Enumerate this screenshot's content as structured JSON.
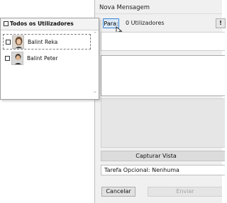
{
  "dialog": {
    "title": "Nova Mensagem",
    "to_button": "Para:",
    "recipients_count": "0 Utilizadores",
    "priority_button": "!",
    "capture_button": "Capturar Vista",
    "task_field": "Tarefa Opcional: Nenhuma",
    "cancel_button": "Cancelar",
    "send_button": "Enviar"
  },
  "user_popup": {
    "select_all_label": "Todos os Utilizadores",
    "users": [
      {
        "name": "Balint Reka",
        "checked": false,
        "focused": true
      },
      {
        "name": "Balint Peter",
        "checked": false,
        "focused": false
      }
    ]
  },
  "colors": {
    "accent": "#3a86d4",
    "to_button_bg": "#dbe9f7",
    "disabled_text": "#a4a4a4"
  }
}
